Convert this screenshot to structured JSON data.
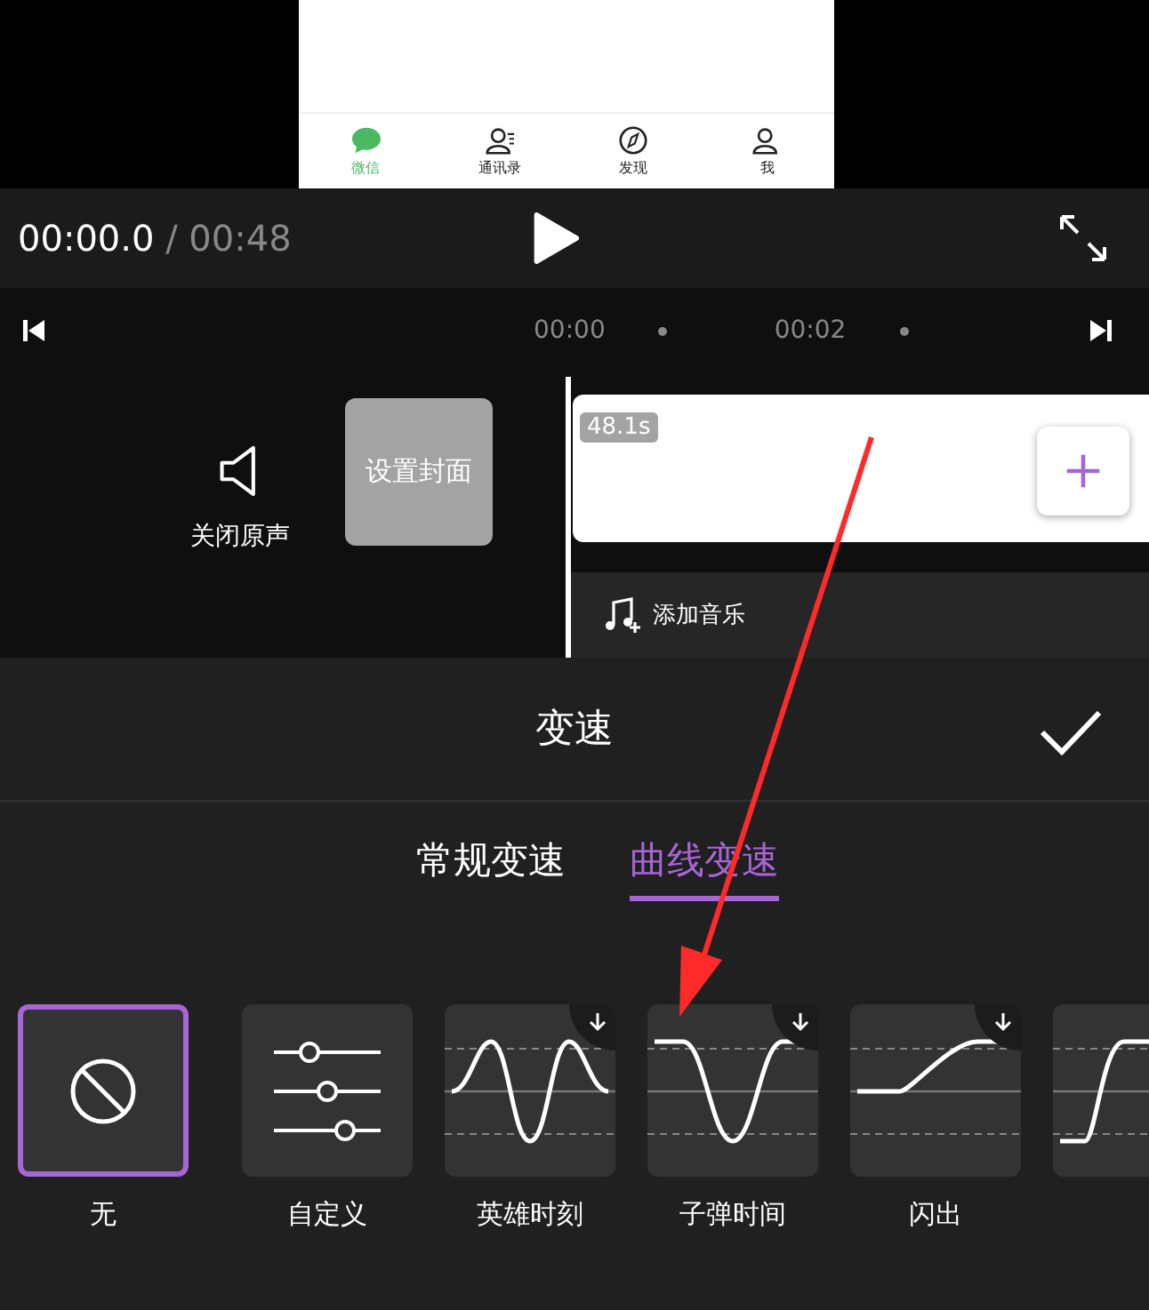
{
  "phone_tab_bar": [
    {
      "label": "微信",
      "selected": true
    },
    {
      "label": "通讯录",
      "selected": false
    },
    {
      "label": "发现",
      "selected": false
    },
    {
      "label": "我",
      "selected": false
    }
  ],
  "player": {
    "current_time": "00:00.0",
    "total_time": "/ 00:48"
  },
  "ruler": {
    "ticks": [
      "00:00",
      "00:02"
    ]
  },
  "track": {
    "mute_label": "关闭原声",
    "cover_button": "设置封面",
    "clip_duration": "48.1s",
    "add_music": "添加音乐"
  },
  "panel": {
    "title": "变速"
  },
  "speed_tabs": [
    {
      "label": "常规变速",
      "selected": false
    },
    {
      "label": "曲线变速",
      "selected": true
    }
  ],
  "presets": [
    {
      "kind": "none",
      "label": "无",
      "selected": true,
      "downloadable": false
    },
    {
      "kind": "custom",
      "label": "自定义",
      "selected": false,
      "downloadable": false
    },
    {
      "kind": "hero",
      "label": "英雄时刻",
      "selected": false,
      "downloadable": true
    },
    {
      "kind": "bullet",
      "label": "子弹时间",
      "selected": false,
      "downloadable": true
    },
    {
      "kind": "flash-in",
      "label": "闪出",
      "selected": false,
      "downloadable": true
    },
    {
      "kind": "jump",
      "selected": false
    }
  ]
}
